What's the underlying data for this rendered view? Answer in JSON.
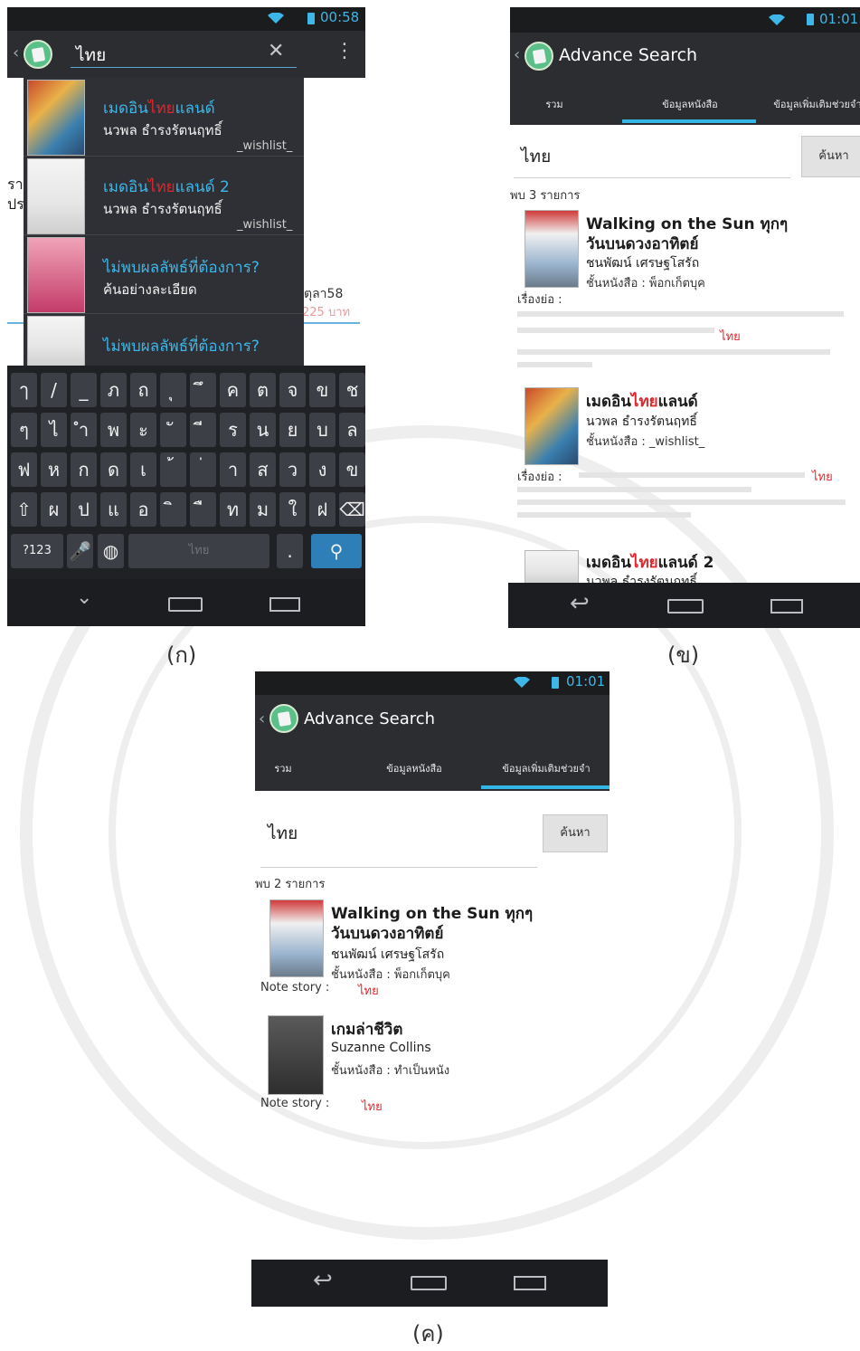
{
  "panel_a": {
    "status_time": "00:58",
    "search_value": "ไทย",
    "suggestions": [
      {
        "title_pre": "เมดอิน",
        "title_hl": "ไทย",
        "title_post": "แลนด์",
        "author": "นวพล ธำรงรัตนฤทธิ์",
        "tag": "_wishlist_"
      },
      {
        "title_pre": "เมดอิน",
        "title_hl": "ไทย",
        "title_post": "แลนด์ 2",
        "author": "นวพล ธำรงรัตนฤทธิ์",
        "tag": "_wishlist_"
      },
      {
        "title_pre": "ไม่พบผลลัพธ์ที่ต้องการ?",
        "title_hl": "",
        "title_post": "",
        "author": "ค้นอย่างละเอียด",
        "tag": ""
      },
      {
        "title_pre": "ไม่พบผลลัพธ์ที่ต้องการ?",
        "title_hl": "",
        "title_post": "",
        "author": "",
        "tag": ""
      }
    ],
    "bg_left_1": "รา",
    "bg_left_2": "ปร",
    "bg_date": "ตุลา58",
    "bg_price": "225 บาท",
    "keyboard": {
      "row1": [
        "ๅ",
        "/",
        "_",
        "ภ",
        "ถ",
        "ุ",
        "ึ",
        "ค",
        "ต",
        "จ",
        "ข",
        "ช"
      ],
      "row2": [
        "ๆ",
        "ไ",
        "ำ",
        "พ",
        "ะ",
        "ั",
        "ี",
        "ร",
        "น",
        "ย",
        "บ",
        "ล"
      ],
      "row3": [
        "ฟ",
        "ห",
        "ก",
        "ด",
        "เ",
        "้",
        "่",
        "า",
        "ส",
        "ว",
        "ง",
        "ข"
      ],
      "row4": [
        "⇧",
        "ผ",
        "ป",
        "แ",
        "อ",
        "ิ",
        "ื",
        "ท",
        "ม",
        "ใ",
        "ฝ",
        "⌫"
      ],
      "row5_left": "?123",
      "space_label": "ไทย",
      "period": "."
    },
    "caption": "(ก)"
  },
  "panel_b": {
    "status_time": "01:01",
    "title": "Advance Search",
    "tabs": [
      "รวม",
      "ข้อมูลหนังสือ",
      "ข้อมูลเพิ่มเติมช่วยจำ"
    ],
    "search_value": "ไทย",
    "search_button": "ค้นหา",
    "result_count": "พบ 3 รายการ",
    "results": [
      {
        "title": "Walking on the Sun ทุกๆ",
        "title2": "วันบนดวงอาทิตย์",
        "author": "ชนพัฒน์ เศรษฐโสรัถ",
        "shelf": "ชั้นหนังสือ : พ็อกเก็ตบุค"
      },
      {
        "title_pre": "เมดอิน",
        "title_hl": "ไทย",
        "title_post": "แลนด์",
        "author": "นวพล ธำรงรัตนฤทธิ์",
        "shelf": "ชั้นหนังสือ : _wishlist_"
      },
      {
        "title_pre": "เมดอิน",
        "title_hl": "ไทย",
        "title_post": "แลนด์ 2",
        "author": "นวพล ธำรงรัตนฤทธิ์",
        "shelf": ""
      }
    ],
    "story_label": "เรื่องย่อ :",
    "highlight": "ไทย",
    "caption": "(ข)"
  },
  "panel_c": {
    "status_time": "01:01",
    "title": "Advance Search",
    "tabs": [
      "รวม",
      "ข้อมูลหนังสือ",
      "ข้อมูลเพิ่มเติมช่วยจำ"
    ],
    "search_value": "ไทย",
    "search_button": "ค้นหา",
    "result_count": "พบ 2 รายการ",
    "results": [
      {
        "title": "Walking on the Sun ทุกๆ",
        "title2": "วันบนดวงอาทิตย์",
        "author": "ชนพัฒน์ เศรษฐโสรัถ",
        "shelf": "ชั้นหนังสือ : พ็อกเก็ตบุค",
        "note_label": "Note story :",
        "note_hl": "ไทย"
      },
      {
        "title": "เกมล่าชีวิต",
        "title2": "",
        "author": "Suzanne Collins",
        "shelf": "ชั้นหนังสือ : ทำเป็นหนัง",
        "note_label": "Note story :",
        "note_hl": "ไทย"
      }
    ],
    "caption": "(ค)"
  },
  "colors": {
    "accent": "#33b5e5",
    "highlight": "#e0262c",
    "actionbar": "#2b2d31",
    "navbar": "#1c1d20"
  },
  "icons": [
    "app-icon",
    "back-chevron-icon",
    "clear-icon",
    "overflow-menu-icon",
    "wifi-icon",
    "battery-icon",
    "back-nav-icon",
    "home-nav-icon",
    "recents-nav-icon",
    "mic-icon",
    "globe-icon",
    "search-key-icon",
    "shift-icon",
    "delete-icon"
  ]
}
